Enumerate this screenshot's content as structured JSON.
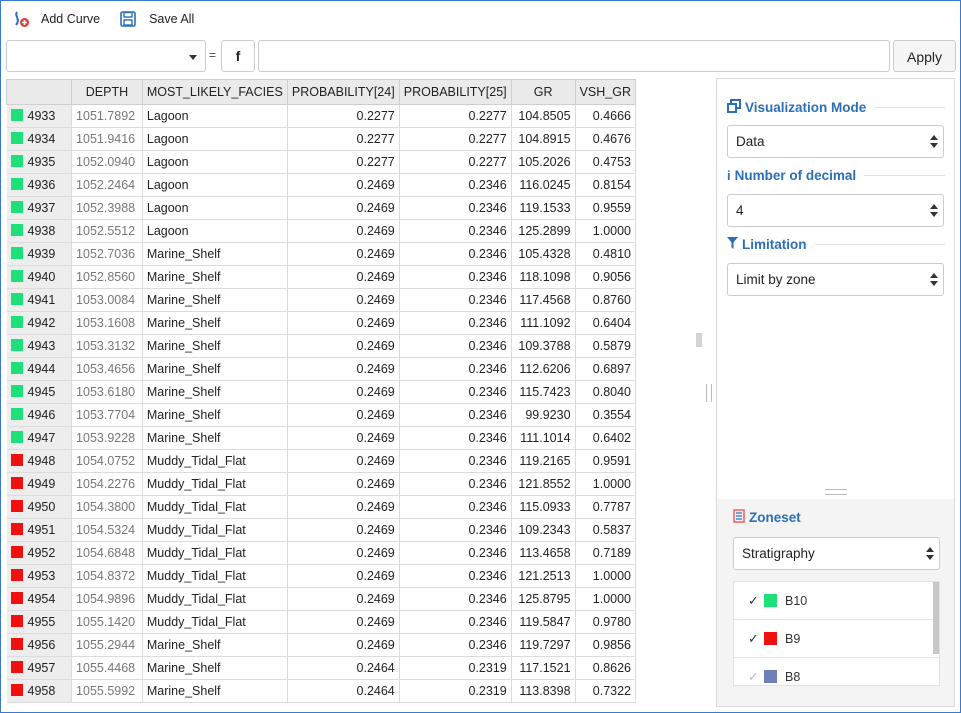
{
  "toolbar": {
    "add_curve_label": "Add Curve",
    "save_all_label": "Save All"
  },
  "formula": {
    "curve_select_value": "",
    "equals": "=",
    "fx_label": "f",
    "expression_value": "",
    "apply_label": "Apply"
  },
  "table": {
    "columns": [
      "",
      "DEPTH",
      "MOST_LIKELY_FACIES",
      "PROBABILITY[24]",
      "PROBABILITY[25]",
      "GR",
      "VSH_GR"
    ],
    "rows": [
      {
        "idx": "4933",
        "color": "#1ee07a",
        "depth": "1051.7892",
        "facies": "Lagoon",
        "p24": "0.2277",
        "p25": "0.2277",
        "gr": "104.8505",
        "vsh": "0.4666"
      },
      {
        "idx": "4934",
        "color": "#1ee07a",
        "depth": "1051.9416",
        "facies": "Lagoon",
        "p24": "0.2277",
        "p25": "0.2277",
        "gr": "104.8915",
        "vsh": "0.4676"
      },
      {
        "idx": "4935",
        "color": "#1ee07a",
        "depth": "1052.0940",
        "facies": "Lagoon",
        "p24": "0.2277",
        "p25": "0.2277",
        "gr": "105.2026",
        "vsh": "0.4753"
      },
      {
        "idx": "4936",
        "color": "#1ee07a",
        "depth": "1052.2464",
        "facies": "Lagoon",
        "p24": "0.2469",
        "p25": "0.2346",
        "gr": "116.0245",
        "vsh": "0.8154"
      },
      {
        "idx": "4937",
        "color": "#1ee07a",
        "depth": "1052.3988",
        "facies": "Lagoon",
        "p24": "0.2469",
        "p25": "0.2346",
        "gr": "119.1533",
        "vsh": "0.9559"
      },
      {
        "idx": "4938",
        "color": "#1ee07a",
        "depth": "1052.5512",
        "facies": "Lagoon",
        "p24": "0.2469",
        "p25": "0.2346",
        "gr": "125.2899",
        "vsh": "1.0000"
      },
      {
        "idx": "4939",
        "color": "#1ee07a",
        "depth": "1052.7036",
        "facies": "Marine_Shelf",
        "p24": "0.2469",
        "p25": "0.2346",
        "gr": "105.4328",
        "vsh": "0.4810"
      },
      {
        "idx": "4940",
        "color": "#1ee07a",
        "depth": "1052.8560",
        "facies": "Marine_Shelf",
        "p24": "0.2469",
        "p25": "0.2346",
        "gr": "118.1098",
        "vsh": "0.9056"
      },
      {
        "idx": "4941",
        "color": "#1ee07a",
        "depth": "1053.0084",
        "facies": "Marine_Shelf",
        "p24": "0.2469",
        "p25": "0.2346",
        "gr": "117.4568",
        "vsh": "0.8760"
      },
      {
        "idx": "4942",
        "color": "#1ee07a",
        "depth": "1053.1608",
        "facies": "Marine_Shelf",
        "p24": "0.2469",
        "p25": "0.2346",
        "gr": "111.1092",
        "vsh": "0.6404"
      },
      {
        "idx": "4943",
        "color": "#1ee07a",
        "depth": "1053.3132",
        "facies": "Marine_Shelf",
        "p24": "0.2469",
        "p25": "0.2346",
        "gr": "109.3788",
        "vsh": "0.5879"
      },
      {
        "idx": "4944",
        "color": "#1ee07a",
        "depth": "1053.4656",
        "facies": "Marine_Shelf",
        "p24": "0.2469",
        "p25": "0.2346",
        "gr": "112.6206",
        "vsh": "0.6897"
      },
      {
        "idx": "4945",
        "color": "#1ee07a",
        "depth": "1053.6180",
        "facies": "Marine_Shelf",
        "p24": "0.2469",
        "p25": "0.2346",
        "gr": "115.7423",
        "vsh": "0.8040"
      },
      {
        "idx": "4946",
        "color": "#1ee07a",
        "depth": "1053.7704",
        "facies": "Marine_Shelf",
        "p24": "0.2469",
        "p25": "0.2346",
        "gr": "99.9230",
        "vsh": "0.3554"
      },
      {
        "idx": "4947",
        "color": "#1ee07a",
        "depth": "1053.9228",
        "facies": "Marine_Shelf",
        "p24": "0.2469",
        "p25": "0.2346",
        "gr": "111.1014",
        "vsh": "0.6402"
      },
      {
        "idx": "4948",
        "color": "#f01010",
        "depth": "1054.0752",
        "facies": "Muddy_Tidal_Flat",
        "p24": "0.2469",
        "p25": "0.2346",
        "gr": "119.2165",
        "vsh": "0.9591"
      },
      {
        "idx": "4949",
        "color": "#f01010",
        "depth": "1054.2276",
        "facies": "Muddy_Tidal_Flat",
        "p24": "0.2469",
        "p25": "0.2346",
        "gr": "121.8552",
        "vsh": "1.0000"
      },
      {
        "idx": "4950",
        "color": "#f01010",
        "depth": "1054.3800",
        "facies": "Muddy_Tidal_Flat",
        "p24": "0.2469",
        "p25": "0.2346",
        "gr": "115.0933",
        "vsh": "0.7787"
      },
      {
        "idx": "4951",
        "color": "#f01010",
        "depth": "1054.5324",
        "facies": "Muddy_Tidal_Flat",
        "p24": "0.2469",
        "p25": "0.2346",
        "gr": "109.2343",
        "vsh": "0.5837"
      },
      {
        "idx": "4952",
        "color": "#f01010",
        "depth": "1054.6848",
        "facies": "Muddy_Tidal_Flat",
        "p24": "0.2469",
        "p25": "0.2346",
        "gr": "113.4658",
        "vsh": "0.7189"
      },
      {
        "idx": "4953",
        "color": "#f01010",
        "depth": "1054.8372",
        "facies": "Muddy_Tidal_Flat",
        "p24": "0.2469",
        "p25": "0.2346",
        "gr": "121.2513",
        "vsh": "1.0000"
      },
      {
        "idx": "4954",
        "color": "#f01010",
        "depth": "1054.9896",
        "facies": "Muddy_Tidal_Flat",
        "p24": "0.2469",
        "p25": "0.2346",
        "gr": "125.8795",
        "vsh": "1.0000"
      },
      {
        "idx": "4955",
        "color": "#f01010",
        "depth": "1055.1420",
        "facies": "Muddy_Tidal_Flat",
        "p24": "0.2469",
        "p25": "0.2346",
        "gr": "119.5847",
        "vsh": "0.9780"
      },
      {
        "idx": "4956",
        "color": "#f01010",
        "depth": "1055.2944",
        "facies": "Marine_Shelf",
        "p24": "0.2469",
        "p25": "0.2346",
        "gr": "119.7297",
        "vsh": "0.9856"
      },
      {
        "idx": "4957",
        "color": "#f01010",
        "depth": "1055.4468",
        "facies": "Marine_Shelf",
        "p24": "0.2464",
        "p25": "0.2319",
        "gr": "117.1521",
        "vsh": "0.8626"
      },
      {
        "idx": "4958",
        "color": "#f01010",
        "depth": "1055.5992",
        "facies": "Marine_Shelf",
        "p24": "0.2464",
        "p25": "0.2319",
        "gr": "113.8398",
        "vsh": "0.7322"
      }
    ]
  },
  "panel": {
    "visualization": {
      "title": "Visualization Mode",
      "icon": "window-restore-icon",
      "value": "Data"
    },
    "decimal": {
      "title": "Number of decimal",
      "icon": "info-icon",
      "value": "4"
    },
    "limitation": {
      "title": "Limitation",
      "icon": "filter-icon",
      "value": "Limit by zone"
    },
    "zoneset": {
      "title": "Zoneset",
      "icon": "list-document-icon",
      "value": "Stratigraphy",
      "items": [
        {
          "name": "B10",
          "color": "#1ee07a",
          "checked": true
        },
        {
          "name": "B9",
          "color": "#f01010",
          "checked": true
        },
        {
          "name": "B8",
          "color": "#6f7fba",
          "checked": true
        }
      ]
    }
  },
  "colors": {
    "accent": "#2c6fb7",
    "frame": "#3c78c8"
  }
}
